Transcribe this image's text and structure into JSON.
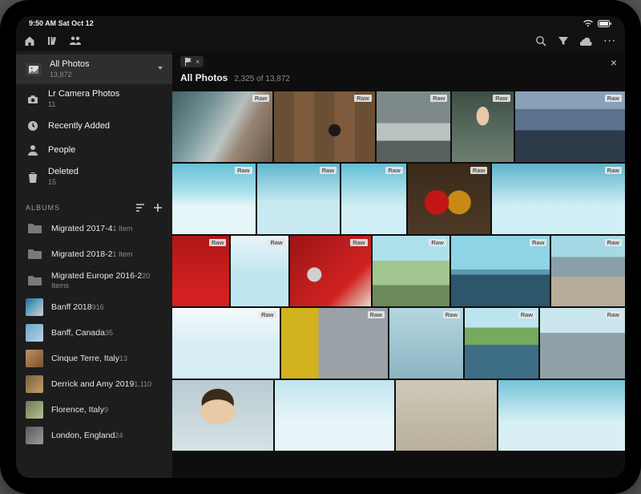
{
  "statusbar": {
    "left": "9:50 AM  Sat Oct 12"
  },
  "sidebar": {
    "fixed_items": [
      {
        "icon": "picture",
        "title": "All Photos",
        "count": "13,872",
        "selected": true,
        "chev": true
      },
      {
        "icon": "camera",
        "title": "Lr Camera Photos",
        "count": "11",
        "selected": false
      },
      {
        "icon": "clock",
        "title": "Recently Added",
        "count": "",
        "selected": false
      },
      {
        "icon": "person",
        "title": "People",
        "count": "",
        "selected": false
      },
      {
        "icon": "trash",
        "title": "Deleted",
        "count": "15",
        "selected": false
      }
    ],
    "section_label": "ALBUMS",
    "albums": [
      {
        "thumb": "folder",
        "title": "Migrated 2017-4",
        "count": "1 Item"
      },
      {
        "thumb": "folder",
        "title": "Migrated 2018-2",
        "count": "1 Item"
      },
      {
        "thumb": "folder",
        "title": "Migrated Europe 2016-2",
        "count": "20 Items"
      },
      {
        "thumb": "ph1",
        "title": "Banff 2018",
        "count": "916"
      },
      {
        "thumb": "ph2",
        "title": "Banff, Canada",
        "count": "35"
      },
      {
        "thumb": "ph3",
        "title": "Cinque Terre, Italy",
        "count": "13"
      },
      {
        "thumb": "ph4",
        "title": "Derrick and Amy 2019",
        "count": "1,110"
      },
      {
        "thumb": "ph5",
        "title": "Florence, Italy",
        "count": "9"
      },
      {
        "thumb": "ph6",
        "title": "London, England",
        "count": "24"
      }
    ]
  },
  "main": {
    "filter_chip": {
      "icon": "flag"
    },
    "title": "All Photos",
    "count": "2,325 of 13,872",
    "raw_badge_label": "Raw",
    "grid_rows": [
      [
        {
          "g": "g-street1",
          "w": 1.35,
          "raw": true
        },
        {
          "g": "g-table",
          "w": 1.35,
          "raw": true
        },
        {
          "g": "g-subway",
          "w": 1.0,
          "raw": true
        },
        {
          "g": "g-portrait",
          "w": 0.82,
          "raw": true
        },
        {
          "g": "g-times",
          "w": 1.48,
          "raw": true
        }
      ],
      [
        {
          "g": "g-sky1",
          "w": 1.0,
          "raw": true
        },
        {
          "g": "g-sky2",
          "w": 1.0,
          "raw": true
        },
        {
          "g": "g-tower1",
          "w": 0.78,
          "raw": true
        },
        {
          "g": "g-drinks",
          "w": 1.0,
          "raw": true
        },
        {
          "g": "g-sky3",
          "w": 1.6,
          "raw": true
        }
      ],
      [
        {
          "g": "g-redwall",
          "w": 0.78,
          "raw": true
        },
        {
          "g": "g-tower2",
          "w": 0.78,
          "raw": true
        },
        {
          "g": "g-car",
          "w": 1.1,
          "raw": true
        },
        {
          "g": "g-park",
          "w": 1.05,
          "raw": true
        },
        {
          "g": "g-marina",
          "w": 1.35,
          "raw": true
        },
        {
          "g": "g-walk",
          "w": 1.0,
          "raw": true
        }
      ],
      [
        {
          "g": "g-tower3",
          "w": 1.45,
          "raw": true
        },
        {
          "g": "g-yellow",
          "w": 1.45,
          "raw": true
        },
        {
          "g": "g-phone",
          "w": 1.0,
          "raw": true
        },
        {
          "g": "g-river",
          "w": 1.0,
          "raw": true
        },
        {
          "g": "g-people",
          "w": 1.15,
          "raw": true
        }
      ],
      [
        {
          "g": "g-woman",
          "w": 1.35,
          "raw": false
        },
        {
          "g": "g-sky4",
          "w": 1.6,
          "raw": false
        },
        {
          "g": "g-room",
          "w": 1.35,
          "raw": false
        },
        {
          "g": "g-sky5",
          "w": 1.7,
          "raw": false
        }
      ]
    ]
  }
}
